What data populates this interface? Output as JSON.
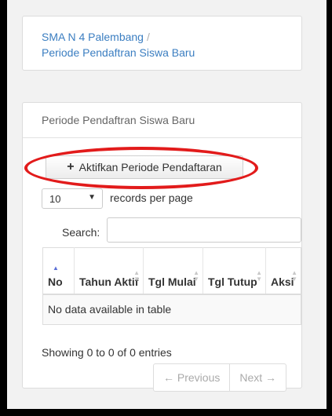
{
  "breadcrumb": {
    "school": "SMA N 4 Palembang",
    "separator": "/",
    "page": "Periode Pendaftran Siswa Baru"
  },
  "panel": {
    "title": "Periode Pendaftran Siswa Baru",
    "activate_button": "Aktifkan Periode Pendaftaran"
  },
  "length": {
    "value": "10",
    "label": "records per page"
  },
  "search": {
    "label": "Search:",
    "value": ""
  },
  "table": {
    "headers": [
      "No",
      "Tahun Aktif",
      "Tgl Mulai",
      "Tgl Tutup",
      "Aksi"
    ],
    "empty_message": "No data available in table"
  },
  "info": "Showing 0 to 0 of 0 entries",
  "pagination": {
    "previous": "← Previous",
    "next": "Next →"
  },
  "colors": {
    "link": "#3b7ec1",
    "highlight": "#e21b1b"
  }
}
